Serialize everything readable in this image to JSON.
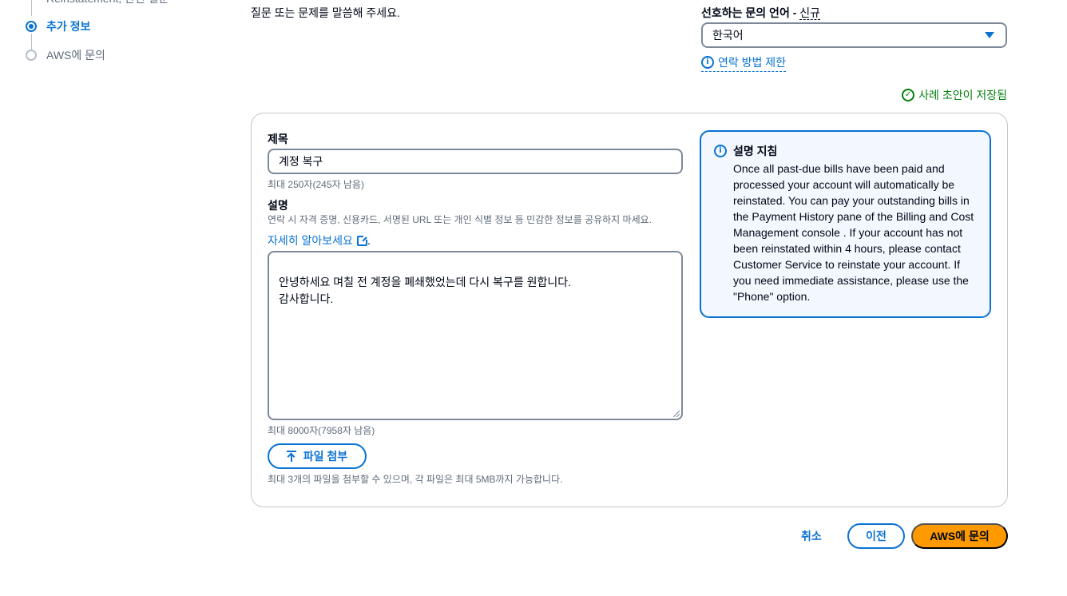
{
  "stepnav": {
    "steps": [
      {
        "label": "Reinstatement, 관련 질문",
        "state": "done"
      },
      {
        "label": "추가 정보",
        "state": "active"
      },
      {
        "label": "AWS에 문의",
        "state": "pending"
      }
    ]
  },
  "form": {
    "top_hint": "질문 또는 문제를 말씀해 주세요.",
    "language": {
      "label": "선호하는 문의 언어 - ",
      "new_badge": "신규",
      "selected": "한국어",
      "contact_limit_link": "연락 방법 제한"
    },
    "draft_status": "사례 초안이 저장됨",
    "subject": {
      "label": "제목",
      "value": "계정 복구",
      "constraint": "최대 250자(245자 남음)"
    },
    "description": {
      "label": "설명",
      "hint": "연락 시 자격 증명, 신용카드, 서명된 URL 또는 개인 식별 정보 등 민감한 정보를 공유하지 마세요.",
      "learn_more": "자세히 알아보세요",
      "learn_more_suffix": ".",
      "value": "안녕하세요 며칠 전 계정을 폐쇄했었는데 다시 복구를 원합니다.\n감사합니다.",
      "constraint": "최대 8000자(7958자 남음)"
    },
    "attachment": {
      "button_label": "파일 첨부",
      "constraint": "최대 3개의 파일을 첨부할 수 있으며, 각 파일은 최대 5MB까지 가능합니다."
    }
  },
  "info_panel": {
    "title": "설명 지침",
    "body": "Once all past-due bills have been paid and processed your account will automatically be reinstated. You can pay your outstanding bills in the Payment History pane of the Billing and Cost Management console . If your account has not been reinstated within 4 hours, please contact Customer Service to reinstate your account. If you need immediate assistance, please use the \"Phone\" option."
  },
  "footer": {
    "cancel_label": "취소",
    "previous_label": "이전",
    "submit_label": "AWS에 문의"
  },
  "colors": {
    "accent": "#0972d3",
    "primary_button": "#ff9900",
    "success": "#037f0c",
    "info_bg": "#f2f8fd"
  }
}
